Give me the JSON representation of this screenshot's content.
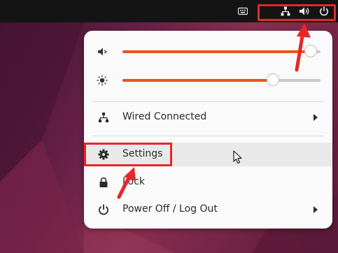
{
  "topbar": {
    "icons": [
      "keyboard-icon",
      "network-wired-icon",
      "volume-icon",
      "power-icon"
    ]
  },
  "menu": {
    "volume_level": 0.95,
    "brightness_level": 0.76,
    "items": [
      {
        "label": "Wired Connected",
        "icon": "network-wired-icon",
        "has_submenu": true
      },
      {
        "label": "Settings",
        "icon": "gear-icon",
        "has_submenu": false
      },
      {
        "label": "Lock",
        "icon": "lock-icon",
        "has_submenu": false
      },
      {
        "label": "Power Off / Log Out",
        "icon": "power-icon",
        "has_submenu": true
      }
    ]
  },
  "colors": {
    "accent": "#e95420",
    "annotation": "#e8262a",
    "panel": "#141414",
    "menu_bg": "#fafafa"
  }
}
